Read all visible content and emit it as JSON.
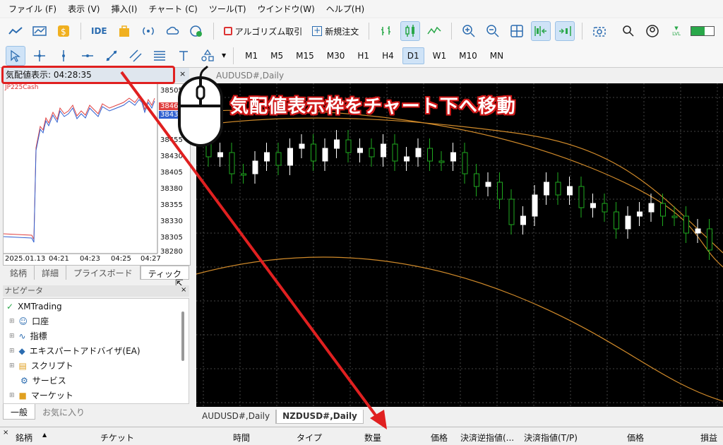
{
  "menu": [
    "ファイル (F)",
    "表示 (V)",
    "挿入(I)",
    "チャート (C)",
    "ツール(T)",
    "ウインドウ(W)",
    "ヘルプ(H)"
  ],
  "toolbar": {
    "ide": "IDE",
    "algo": "アルゴリズム取引",
    "neworder": "新規注文",
    "lvl": "LVL"
  },
  "timeframes": [
    "M1",
    "M5",
    "M15",
    "M30",
    "H1",
    "H4",
    "D1",
    "W1",
    "M10",
    "MN"
  ],
  "active_timeframe": "D1",
  "quote": {
    "header": "気配値表示: 04:28:35",
    "symbol": "JP225Cash",
    "close": "×",
    "prices": [
      "38505",
      "3846",
      "3843",
      "38455",
      "38430",
      "38405",
      "38380",
      "38355",
      "38330",
      "38305",
      "38280"
    ],
    "times": [
      "2025.01.13",
      "04:21",
      "04:23",
      "04:25",
      "04:27"
    ],
    "tabs": [
      "銘柄",
      "詳細",
      "プライスボード",
      "ティック"
    ],
    "active_tab": "ティック"
  },
  "navigator": {
    "header": "ナビゲータ",
    "close": "×",
    "root": "XMTrading",
    "items": [
      "口座",
      "指標",
      "エキスパートアドバイザ(EA)",
      "スクリプト",
      "サービス",
      "マーケット"
    ],
    "tabs": [
      "一般",
      "お気に入り"
    ]
  },
  "chart": {
    "title": "AUDUSD#,Daily",
    "tabs": [
      "AUDUSD#,Daily",
      "NZDUSD#,Daily"
    ],
    "active_tab": "NZDUSD#,Daily",
    "candles": [
      3,
      -2,
      4,
      -1,
      -4,
      -3,
      2,
      -5,
      -2,
      3,
      -4,
      -3,
      2,
      -2,
      1,
      -4,
      3,
      -2,
      -3,
      2,
      -1,
      -3,
      4,
      2,
      -2,
      3,
      5,
      -3,
      -6,
      -4,
      2,
      -3,
      4,
      -2,
      1,
      3,
      -4,
      -2,
      -3,
      2,
      -1,
      3,
      -2,
      4
    ]
  },
  "caption": "気配値表示枠をチャート下へ移動",
  "terminal": {
    "close": "×",
    "columns": [
      "銘柄",
      "チケット",
      "時間",
      "タイプ",
      "数量",
      "価格",
      "決済逆指値(...",
      "決済指値(T/P)",
      "価格",
      "損益"
    ]
  },
  "colors": {
    "highlight": "#e02020",
    "bull": "#ffffff",
    "bear": "#1faa1f",
    "ma": "#d08a2a"
  }
}
